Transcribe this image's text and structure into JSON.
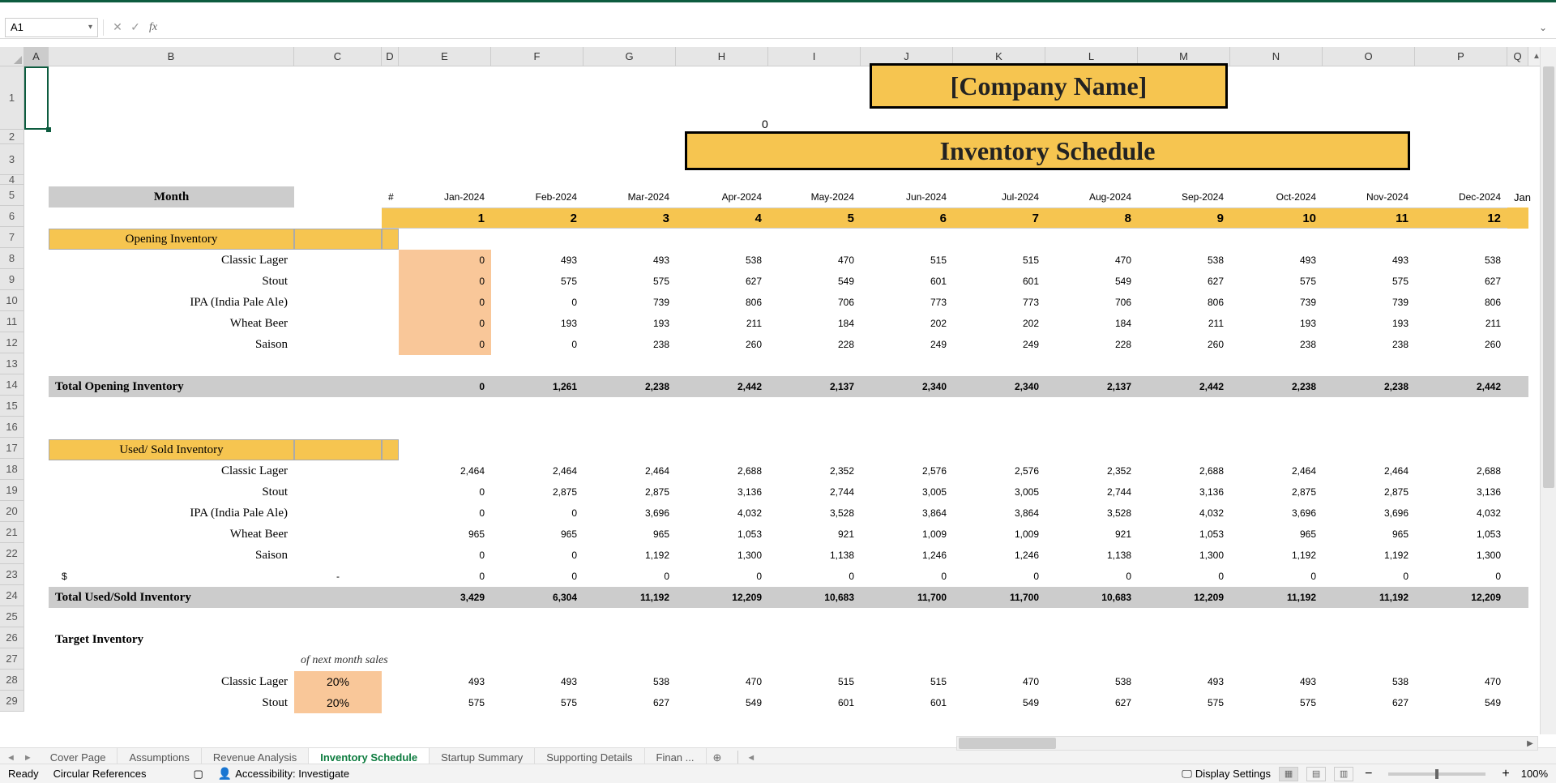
{
  "namebox": "A1",
  "titles": {
    "company": "[Company Name]",
    "page": "Inventory Schedule"
  },
  "zero_above": "0",
  "columns": [
    "A",
    "B",
    "C",
    "D",
    "E",
    "F",
    "G",
    "H",
    "I",
    "J",
    "K",
    "L",
    "M",
    "N",
    "O",
    "P",
    "Q"
  ],
  "row5": {
    "label": "Month",
    "hash": "#",
    "months": [
      "Jan-2024",
      "Feb-2024",
      "Mar-2024",
      "Apr-2024",
      "May-2024",
      "Jun-2024",
      "Jul-2024",
      "Aug-2024",
      "Sep-2024",
      "Oct-2024",
      "Nov-2024",
      "Dec-2024"
    ],
    "right_edge": "Jan"
  },
  "row6": [
    1,
    2,
    3,
    4,
    5,
    6,
    7,
    8,
    9,
    10,
    11,
    12
  ],
  "row7_header": "Opening Inventory",
  "opening": {
    "rows": [
      {
        "name": "Classic Lager",
        "vals": [
          0,
          493,
          493,
          538,
          470,
          515,
          515,
          470,
          538,
          493,
          493,
          538
        ]
      },
      {
        "name": "Stout",
        "vals": [
          0,
          575,
          575,
          627,
          549,
          601,
          601,
          549,
          627,
          575,
          575,
          627
        ]
      },
      {
        "name": "IPA (India Pale Ale)",
        "vals": [
          0,
          0,
          739,
          806,
          706,
          773,
          773,
          706,
          806,
          739,
          739,
          806
        ]
      },
      {
        "name": "Wheat Beer",
        "vals": [
          0,
          193,
          193,
          211,
          184,
          202,
          202,
          184,
          211,
          193,
          193,
          211
        ]
      },
      {
        "name": "Saison",
        "vals": [
          0,
          0,
          238,
          260,
          228,
          249,
          249,
          228,
          260,
          238,
          238,
          260
        ]
      }
    ],
    "total_label": "Total Opening Inventory",
    "totals": [
      "0",
      "1,261",
      "2,238",
      "2,442",
      "2,137",
      "2,340",
      "2,340",
      "2,137",
      "2,442",
      "2,238",
      "2,238",
      "2,442"
    ]
  },
  "row17_header": "Used/ Sold Inventory",
  "used": {
    "rows": [
      {
        "name": "Classic Lager",
        "vals": [
          "2,464",
          "2,464",
          "2,464",
          "2,688",
          "2,352",
          "2,576",
          "2,576",
          "2,352",
          "2,688",
          "2,464",
          "2,464",
          "2,688"
        ]
      },
      {
        "name": "Stout",
        "vals": [
          "0",
          "2,875",
          "2,875",
          "3,136",
          "2,744",
          "3,005",
          "3,005",
          "2,744",
          "3,136",
          "2,875",
          "2,875",
          "3,136"
        ]
      },
      {
        "name": "IPA (India Pale Ale)",
        "vals": [
          "0",
          "0",
          "3,696",
          "4,032",
          "3,528",
          "3,864",
          "3,864",
          "3,528",
          "4,032",
          "3,696",
          "3,696",
          "4,032"
        ]
      },
      {
        "name": "Wheat Beer",
        "vals": [
          "965",
          "965",
          "965",
          "1,053",
          "921",
          "1,009",
          "1,009",
          "921",
          "1,053",
          "965",
          "965",
          "1,053"
        ]
      },
      {
        "name": "Saison",
        "vals": [
          "0",
          "0",
          "1,192",
          "1,300",
          "1,138",
          "1,246",
          "1,246",
          "1,138",
          "1,300",
          "1,192",
          "1,192",
          "1,300"
        ]
      }
    ],
    "dollar_row": {
      "label": "$",
      "dash": "-",
      "vals": [
        "0",
        "0",
        "0",
        "0",
        "0",
        "0",
        "0",
        "0",
        "0",
        "0",
        "0",
        "0"
      ]
    },
    "total_label": "Total Used/Sold Inventory",
    "totals": [
      "3,429",
      "6,304",
      "11,192",
      "12,209",
      "10,683",
      "11,700",
      "11,700",
      "10,683",
      "12,209",
      "11,192",
      "11,192",
      "12,209"
    ]
  },
  "row26_header": "Target Inventory",
  "row27_note": "of next month sales",
  "target": {
    "rows": [
      {
        "name": "Classic Lager",
        "pct": "20%",
        "vals": [
          "493",
          "493",
          "538",
          "470",
          "515",
          "515",
          "470",
          "538",
          "493",
          "493",
          "538",
          "470"
        ]
      },
      {
        "name": "Stout",
        "pct": "20%",
        "vals": [
          "575",
          "575",
          "627",
          "549",
          "601",
          "601",
          "549",
          "627",
          "575",
          "575",
          "627",
          "549"
        ]
      }
    ]
  },
  "tabs": [
    "Cover Page",
    "Assumptions",
    "Revenue Analysis",
    "Inventory Schedule",
    "Startup Summary",
    "Supporting Details",
    "Finan"
  ],
  "active_tab": "Inventory Schedule",
  "status": {
    "ready": "Ready",
    "circular": "Circular References",
    "accessibility": "Accessibility: Investigate",
    "display": "Display Settings",
    "zoom": "100%"
  }
}
